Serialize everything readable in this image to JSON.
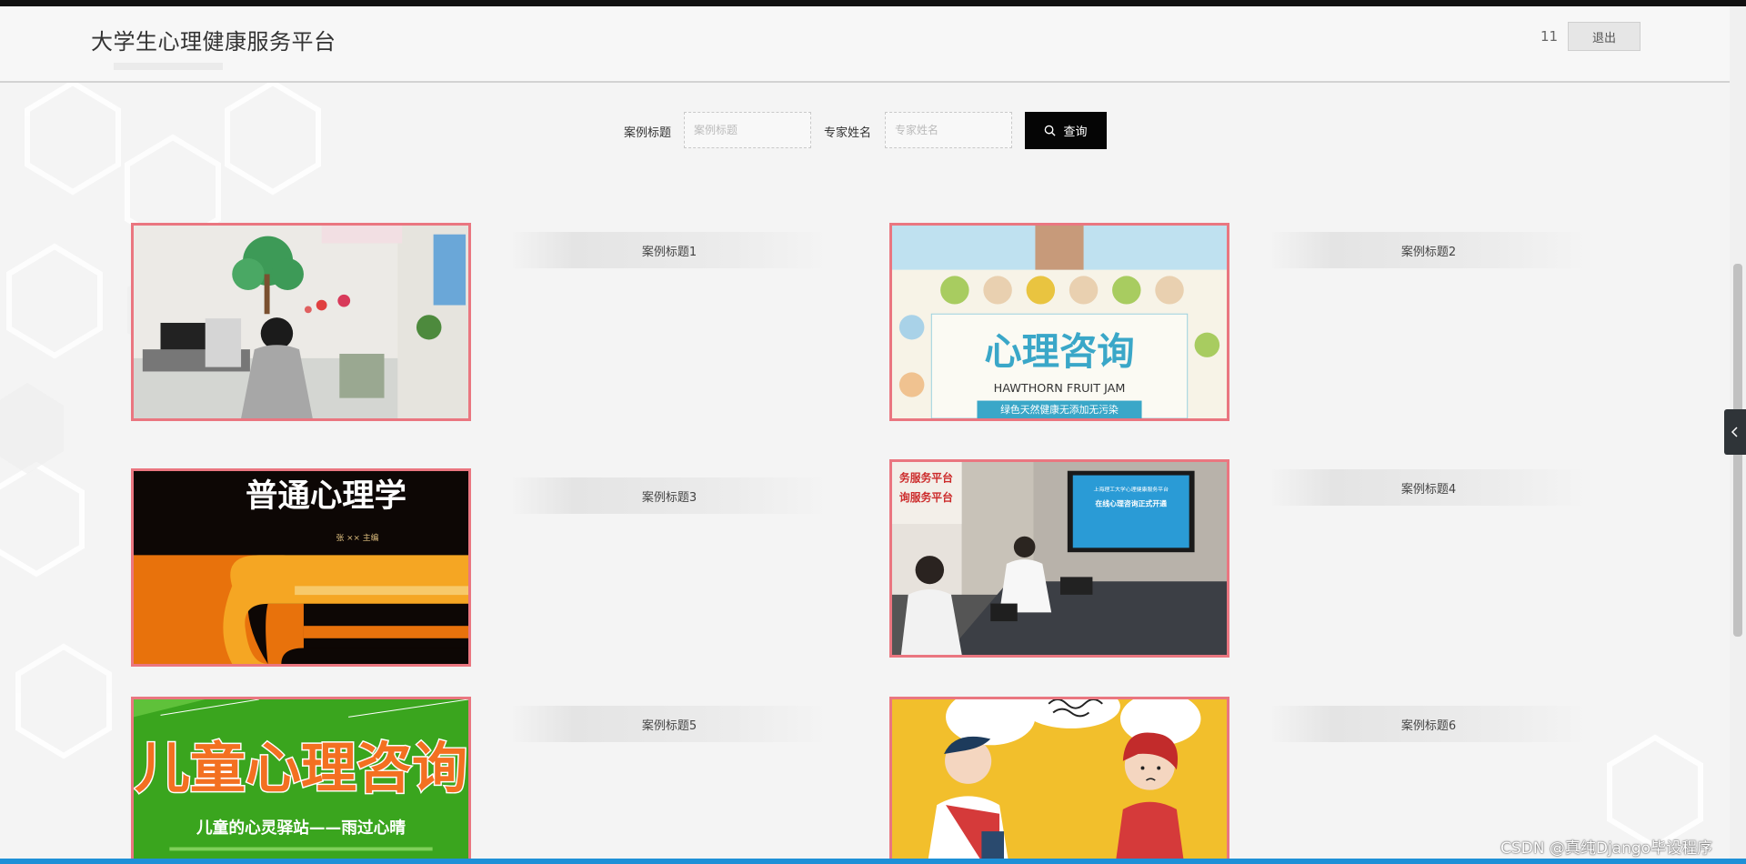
{
  "header": {
    "site_title": "大学生心理健康服务平台",
    "user_name": "11",
    "logout_label": "退出"
  },
  "search": {
    "case_title_label": "案例标题",
    "case_title_placeholder": "案例标题",
    "expert_name_label": "专家姓名",
    "expert_name_placeholder": "专家姓名",
    "button_label": "查询"
  },
  "cases": [
    {
      "title": "案例标题1",
      "image": "counseling-room-photo"
    },
    {
      "title": "案例标题2",
      "image": "psych-consult-poster",
      "poster_main": "心理咨询",
      "poster_sub": "HAWTHORN FRUIT JAM",
      "poster_tag": "绿色天然健康无添加无污染"
    },
    {
      "title": "案例标题3",
      "image": "general-psychology-book-cover",
      "cover_title": "普通心理学",
      "cover_author": "张 ×× 主编"
    },
    {
      "title": "案例标题4",
      "image": "meeting-room-photo",
      "banner_left_1": "务服务平台",
      "banner_left_2": "询服务平台",
      "screen_title": "上海理工大学心理健康服务平台",
      "screen_sub": "在线心理咨询正式开通"
    },
    {
      "title": "案例标题5",
      "image": "child-psych-poster",
      "poster_main": "儿童心理咨询",
      "poster_sub": "儿童的心灵驿站——雨过心晴"
    },
    {
      "title": "案例标题6",
      "image": "conversation-illustration"
    }
  ],
  "watermark": "CSDN @真纯Django毕设程序",
  "colors": {
    "card_border": "#ea7680",
    "search_button": "#050505",
    "bottom_strip": "#1e90d7"
  }
}
